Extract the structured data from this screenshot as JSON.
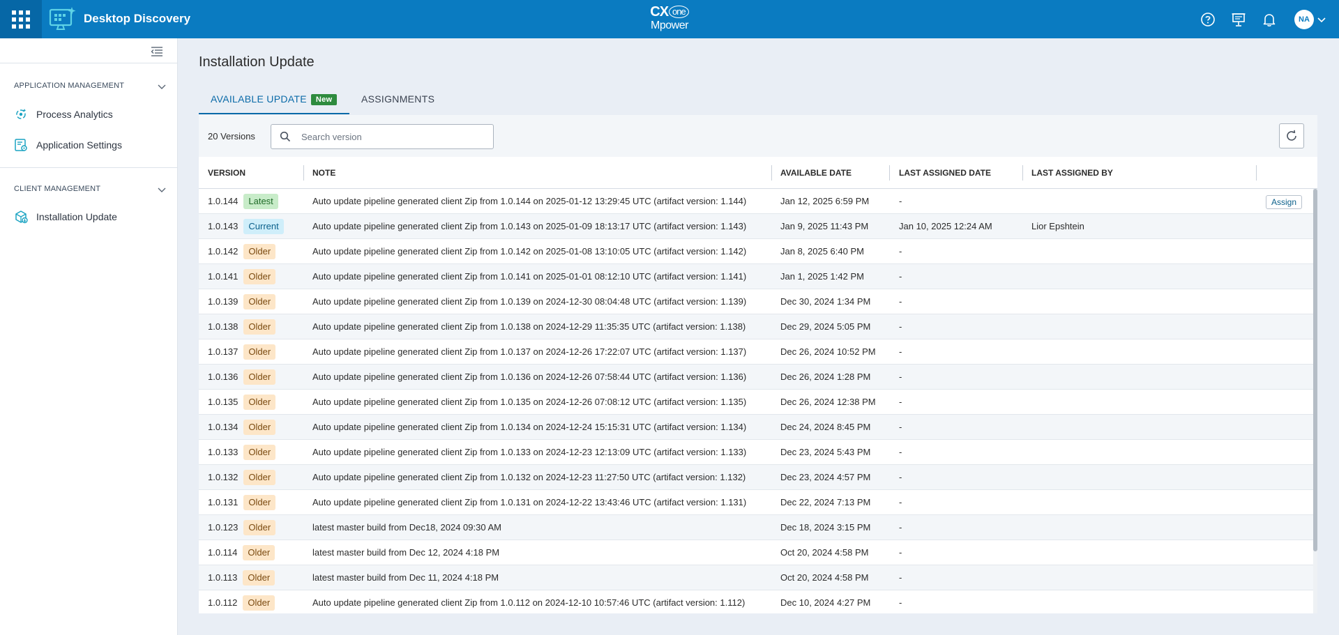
{
  "header": {
    "app_title": "Desktop Discovery",
    "brand_top": "CX",
    "brand_circle": "one",
    "brand_bottom": "Mpower",
    "avatar_initials": "NA"
  },
  "sidebar": {
    "sections": [
      {
        "label": "APPLICATION MANAGEMENT",
        "items": [
          {
            "label": "Process Analytics"
          },
          {
            "label": "Application Settings"
          }
        ]
      },
      {
        "label": "CLIENT MANAGEMENT",
        "items": [
          {
            "label": "Installation Update"
          }
        ]
      }
    ]
  },
  "page": {
    "title": "Installation Update",
    "tabs": [
      {
        "label": "AVAILABLE UPDATE",
        "badge": "New",
        "active": true
      },
      {
        "label": "ASSIGNMENTS",
        "active": false
      }
    ]
  },
  "toolbar": {
    "versions_count": "20 Versions",
    "search_placeholder": "Search version",
    "search_value": ""
  },
  "table": {
    "columns": [
      "VERSION",
      "NOTE",
      "AVAILABLE DATE",
      "LAST ASSIGNED DATE",
      "LAST ASSIGNED BY"
    ],
    "assign_label": "Assign",
    "rows": [
      {
        "version": "1.0.144",
        "status": "Latest",
        "note": "Auto update pipeline generated client Zip from 1.0.144 on 2025-01-12 13:29:45 UTC (artifact version: 1.144)",
        "available_date": "Jan 12, 2025 6:59 PM",
        "last_assigned_date": "-",
        "last_assigned_by": ""
      },
      {
        "version": "1.0.143",
        "status": "Current",
        "note": "Auto update pipeline generated client Zip from 1.0.143 on 2025-01-09 18:13:17 UTC (artifact version: 1.143)",
        "available_date": "Jan 9, 2025 11:43 PM",
        "last_assigned_date": "Jan 10, 2025 12:24 AM",
        "last_assigned_by": "Lior Epshtein"
      },
      {
        "version": "1.0.142",
        "status": "Older",
        "note": "Auto update pipeline generated client Zip from 1.0.142 on 2025-01-08 13:10:05 UTC (artifact version: 1.142)",
        "available_date": "Jan 8, 2025 6:40 PM",
        "last_assigned_date": "-",
        "last_assigned_by": ""
      },
      {
        "version": "1.0.141",
        "status": "Older",
        "note": "Auto update pipeline generated client Zip from 1.0.141 on 2025-01-01 08:12:10 UTC (artifact version: 1.141)",
        "available_date": "Jan 1, 2025 1:42 PM",
        "last_assigned_date": "-",
        "last_assigned_by": ""
      },
      {
        "version": "1.0.139",
        "status": "Older",
        "note": "Auto update pipeline generated client Zip from 1.0.139 on 2024-12-30 08:04:48 UTC (artifact version: 1.139)",
        "available_date": "Dec 30, 2024 1:34 PM",
        "last_assigned_date": "-",
        "last_assigned_by": ""
      },
      {
        "version": "1.0.138",
        "status": "Older",
        "note": "Auto update pipeline generated client Zip from 1.0.138 on 2024-12-29 11:35:35 UTC (artifact version: 1.138)",
        "available_date": "Dec 29, 2024 5:05 PM",
        "last_assigned_date": "-",
        "last_assigned_by": ""
      },
      {
        "version": "1.0.137",
        "status": "Older",
        "note": "Auto update pipeline generated client Zip from 1.0.137 on 2024-12-26 17:22:07 UTC (artifact version: 1.137)",
        "available_date": "Dec 26, 2024 10:52 PM",
        "last_assigned_date": "-",
        "last_assigned_by": ""
      },
      {
        "version": "1.0.136",
        "status": "Older",
        "note": "Auto update pipeline generated client Zip from 1.0.136 on 2024-12-26 07:58:44 UTC (artifact version: 1.136)",
        "available_date": "Dec 26, 2024 1:28 PM",
        "last_assigned_date": "-",
        "last_assigned_by": ""
      },
      {
        "version": "1.0.135",
        "status": "Older",
        "note": "Auto update pipeline generated client Zip from 1.0.135 on 2024-12-26 07:08:12 UTC (artifact version: 1.135)",
        "available_date": "Dec 26, 2024 12:38 PM",
        "last_assigned_date": "-",
        "last_assigned_by": ""
      },
      {
        "version": "1.0.134",
        "status": "Older",
        "note": "Auto update pipeline generated client Zip from 1.0.134 on 2024-12-24 15:15:31 UTC (artifact version: 1.134)",
        "available_date": "Dec 24, 2024 8:45 PM",
        "last_assigned_date": "-",
        "last_assigned_by": ""
      },
      {
        "version": "1.0.133",
        "status": "Older",
        "note": "Auto update pipeline generated client Zip from 1.0.133 on 2024-12-23 12:13:09 UTC (artifact version: 1.133)",
        "available_date": "Dec 23, 2024 5:43 PM",
        "last_assigned_date": "-",
        "last_assigned_by": ""
      },
      {
        "version": "1.0.132",
        "status": "Older",
        "note": "Auto update pipeline generated client Zip from 1.0.132 on 2024-12-23 11:27:50 UTC (artifact version: 1.132)",
        "available_date": "Dec 23, 2024 4:57 PM",
        "last_assigned_date": "-",
        "last_assigned_by": ""
      },
      {
        "version": "1.0.131",
        "status": "Older",
        "note": "Auto update pipeline generated client Zip from 1.0.131 on 2024-12-22 13:43:46 UTC (artifact version: 1.131)",
        "available_date": "Dec 22, 2024 7:13 PM",
        "last_assigned_date": "-",
        "last_assigned_by": ""
      },
      {
        "version": "1.0.123",
        "status": "Older",
        "note": "latest master build from Dec18, 2024 09:30 AM",
        "available_date": "Dec 18, 2024 3:15 PM",
        "last_assigned_date": "-",
        "last_assigned_by": ""
      },
      {
        "version": "1.0.114",
        "status": "Older",
        "note": "latest master build from Dec 12, 2024 4:18 PM",
        "available_date": "Oct 20, 2024 4:58 PM",
        "last_assigned_date": "-",
        "last_assigned_by": ""
      },
      {
        "version": "1.0.113",
        "status": "Older",
        "note": "latest master build from Dec 11, 2024 4:18 PM",
        "available_date": "Oct 20, 2024 4:58 PM",
        "last_assigned_date": "-",
        "last_assigned_by": ""
      },
      {
        "version": "1.0.112",
        "status": "Older",
        "note": "Auto update pipeline generated client Zip from 1.0.112 on 2024-12-10 10:57:46 UTC (artifact version: 1.112)",
        "available_date": "Dec 10, 2024 4:27 PM",
        "last_assigned_date": "-",
        "last_assigned_by": ""
      }
    ]
  },
  "colors": {
    "header_bg": "#0a7bc1",
    "tab_active": "#0a6aa8",
    "new_badge": "#2e8b3e",
    "latest_badge": "#c8ecc9",
    "current_badge": "#cfeefa",
    "older_badge": "#fde6c8"
  },
  "icons": {
    "header": [
      "app-launcher-icon",
      "desktop-discovery-logo-icon",
      "help-icon",
      "presentation-icon",
      "bell-icon",
      "chevron-down-icon"
    ],
    "sidebar": [
      "collapse-sidebar-icon",
      "process-analytics-icon",
      "application-settings-icon",
      "installation-update-icon"
    ],
    "toolbar": [
      "search-icon",
      "refresh-icon"
    ]
  }
}
